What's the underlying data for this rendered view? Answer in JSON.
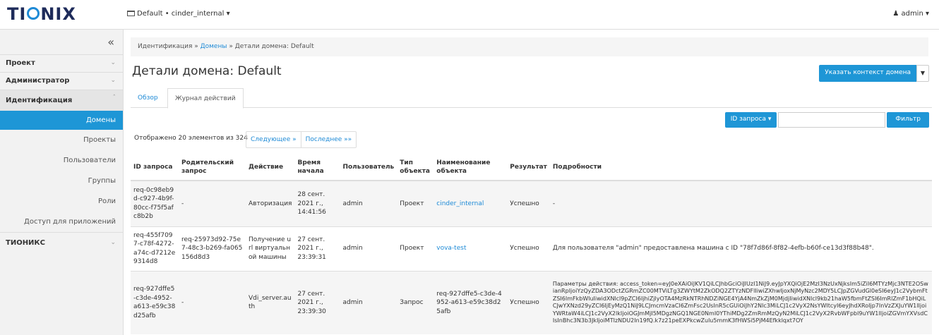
{
  "brand": {
    "logo_text": "TIONIX",
    "logo_color": "#1e2b5a",
    "accent": "#1e96d6"
  },
  "header": {
    "context": "Default • cinder_internal ▾",
    "user": "admin ▾"
  },
  "sidebar": {
    "collapse_icon": "«",
    "sections": [
      {
        "label": "Проект",
        "open": false
      },
      {
        "label": "Администратор",
        "open": false
      },
      {
        "label": "Идентификация",
        "open": true
      }
    ],
    "items": [
      {
        "label": "Домены",
        "active": true
      },
      {
        "label": "Проекты"
      },
      {
        "label": "Пользователи"
      },
      {
        "label": "Группы"
      },
      {
        "label": "Роли"
      },
      {
        "label": "Доступ для приложений"
      }
    ],
    "section_last": "ТИОНИКС"
  },
  "breadcrumb": {
    "part1": "Идентификация",
    "sep": " » ",
    "part2": "Домены",
    "part3": "Детали домена: Default"
  },
  "page_title": "Детали домена: Default",
  "context_button": "Указать контекст домена",
  "tabs": [
    "Обзор",
    "Журнал действий"
  ],
  "filter": {
    "dropdown_label": "ID запроса ▾",
    "input_value": "",
    "button_label": "Фильтр"
  },
  "table": {
    "count_text": "Отображено 20 элементов из 324",
    "pager": [
      "Следующее »",
      "Последнее »»"
    ],
    "columns": [
      "ID запроса",
      "Родительский запрос",
      "Действие",
      "Время начала",
      "Пользователь",
      "Тип объекта",
      "Наименование объекта",
      "Результат",
      "Подробности"
    ],
    "rows": [
      {
        "id": "req-0c98eb9d-c927-4b9f-80cc-f75f5afc8b2b",
        "parent": "-",
        "action": "Авторизация",
        "time": "28 сент. 2021 г., 14:41:56",
        "user": "admin",
        "obj_type": "Проект",
        "obj_name": "cinder_internal",
        "result": "Успешно",
        "details": "-"
      },
      {
        "id": "req-455f7097-c78f-4272-a74c-d7212e9314d8",
        "parent": "req-25973d92-75e7-48c3-b269-fa065156d8d3",
        "action": "Получение url виртуальной машины",
        "time": "27 сент. 2021 г., 23:39:31",
        "user": "admin",
        "obj_type": "Проект",
        "obj_name": "vova-test",
        "result": "Успешно",
        "details": "Для пользователя \"admin\" предоставлена машина с ID \"78f7d86f-8f82-4efb-b60f-ce13d3f88b48\"."
      },
      {
        "id": "req-927dffe5-c3de-4952-a613-e59c38d25afb",
        "parent": "-",
        "action": "Vdi_server.auth",
        "time": "27 сент. 2021 г., 23:39:30",
        "user": "admin",
        "obj_type": "Запрос",
        "obj_name": "req-927dffe5-c3de-4952-a613-e59c38d25afb",
        "result": "Успешно",
        "details": "Параметры действия: access_token=eyJ0eXAiOiJKV1QiLCJhbGciOiJIUzI1NiJ9.eyJpYXQiOjE2MzI3NzUxNjksIm5iZiI6MTYzMjc3NTE2OSwianRpIjoiYzQyZDA3ODctZGRmZC00MTViLTg3ZWYtM2ZkODQ2ZTYzNDFlIiwiZXhwIjoxNjMyNzc2MDY5LCJpZGVudGl0eSI6eyJ1c2VybmFtZSI6ImFkbWluIiwidXNlcl9pZCI6IjhiZjlyOTA4MzRkNTRhNDZiNGE4YjA4NmZkZjM0MjdjIiwidXNlcl9kb21haW5fbmFtZSI6ImRlZmF1bHQiLCJwYXNzd29yZCI6IjEyMzQ1NiJ9LCJmcmVzaCI6ZmFsc2UsInR5cGUiOiJhY2Nlc3MiLCJ1c2VyX2NsYWltcyI6eyJhdXRoIjp7InVzZXJuYW1lIjoiYWRtaW4iLCJ1c2VyX2lkIjoiOGJmMjI5MDgzNGQ1NGE0NmI0YThiMDg2ZmRmMzQyN2MiLCJ1c2VyX2RvbWFpbl9uYW1lIjoiZGVmYXVsdCIsInBhc3N3b3JkIjoiMTIzNDU2In19fQ.k7z21peEXPkcwZulu5mmK3fHWSi5PjM4Efkklqxt7OY"
      }
    ]
  }
}
